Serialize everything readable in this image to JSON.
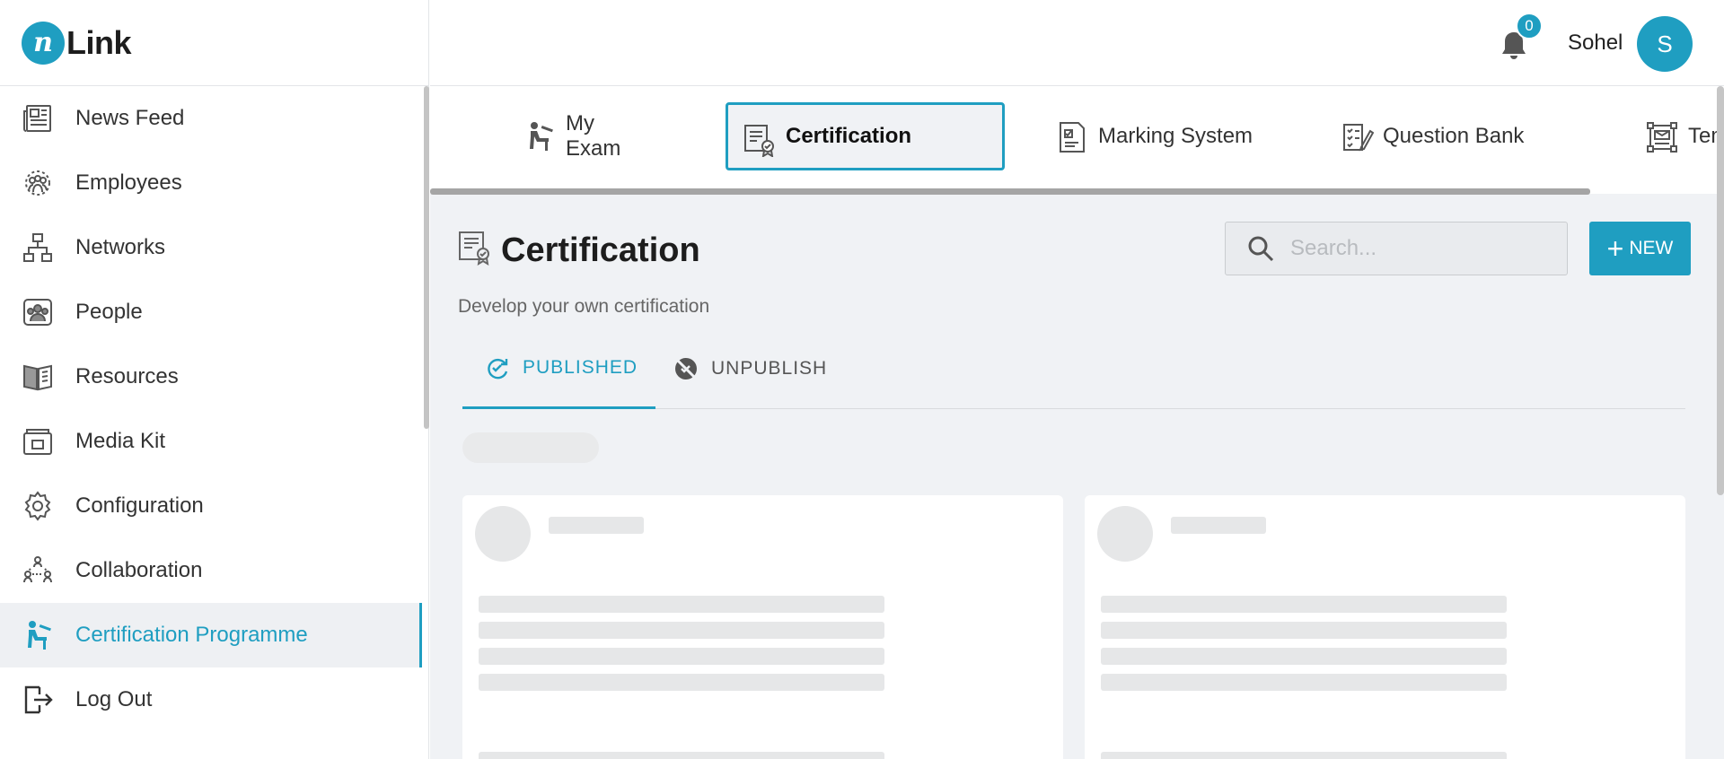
{
  "brand": {
    "logo_mark": "n",
    "logo_text": "Link",
    "accent": "#1f9ec1"
  },
  "sidebar": {
    "items": [
      {
        "label": "News Feed",
        "icon": "newspaper-icon"
      },
      {
        "label": "Employees",
        "icon": "employees-icon"
      },
      {
        "label": "Networks",
        "icon": "network-icon"
      },
      {
        "label": "People",
        "icon": "people-icon"
      },
      {
        "label": "Resources",
        "icon": "book-icon"
      },
      {
        "label": "Media Kit",
        "icon": "media-kit-icon"
      },
      {
        "label": "Configuration",
        "icon": "gear-icon"
      },
      {
        "label": "Collaboration",
        "icon": "collaboration-icon"
      },
      {
        "label": "Certification Programme",
        "icon": "exam-person-icon",
        "active": true
      },
      {
        "label": "Log Out",
        "icon": "logout-icon"
      }
    ]
  },
  "header": {
    "notification_count": "0",
    "username": "Sohel",
    "avatar_initial": "S"
  },
  "tabs": [
    {
      "label": "My Exam",
      "icon": "exam-person-icon"
    },
    {
      "label": "Certification",
      "icon": "certificate-icon",
      "selected": true
    },
    {
      "label": "Marking System",
      "icon": "marking-icon"
    },
    {
      "label": "Question Bank",
      "icon": "question-bank-icon"
    },
    {
      "label": "Temp",
      "icon": "template-icon"
    }
  ],
  "page": {
    "title": "Certification",
    "subtitle": "Develop your own certification",
    "search_placeholder": "Search...",
    "new_button": "NEW"
  },
  "subtabs": [
    {
      "label": "PUBLISHED",
      "icon": "published-icon",
      "active": true
    },
    {
      "label": "UNPUBLISH",
      "icon": "unpublish-icon",
      "active": false
    }
  ]
}
